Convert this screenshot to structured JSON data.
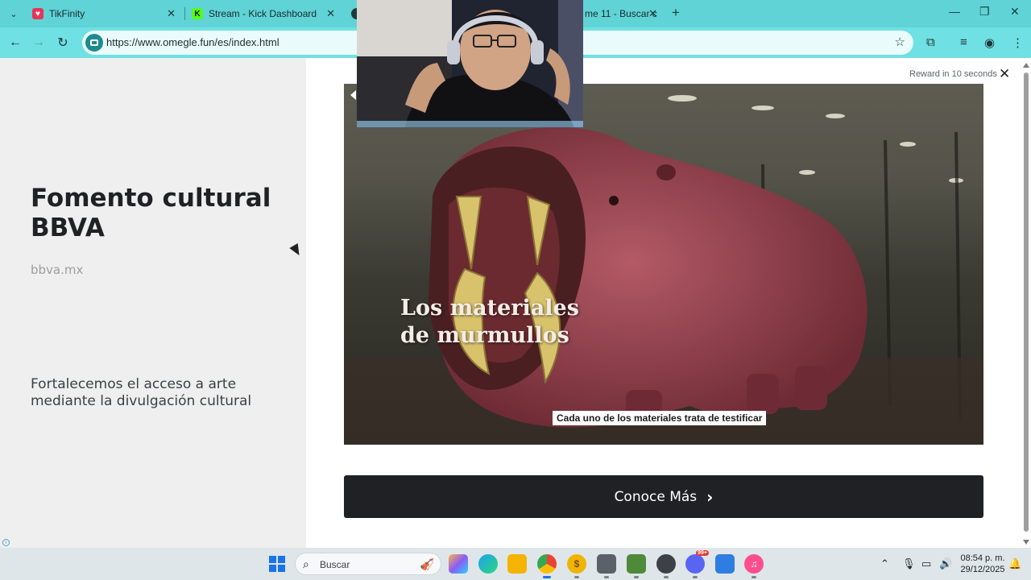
{
  "browser": {
    "tabs": [
      {
        "label": "TikFinity",
        "favicon": "tikfinity-icon",
        "color": "#e8345b"
      },
      {
        "label": "Stream - Kick Dashboard",
        "favicon": "kick-icon",
        "color": "#53fc18"
      },
      {
        "label": "",
        "favicon": "globe-icon",
        "color": "#1d3b3c"
      },
      {
        "label": "me 11 - Buscar c",
        "favicon": "",
        "color": ""
      }
    ],
    "url": "https://www.omegle.fun/es/index.html",
    "accent": "#5fd3d6"
  },
  "ad": {
    "title": "Fomento cultural BBVA",
    "domain": "bbva.mx",
    "description": "Fortalecemos el acceso a arte mediante la divulgación cultural",
    "reward": "Reward in 10 seconds",
    "cta_label": "Conoce Más",
    "video_overlay_line1": "Los materiales",
    "video_overlay_line2": "de murmullos",
    "video_caption": "Cada uno de los materiales trata de testificar"
  },
  "taskbar": {
    "search_placeholder": "Buscar",
    "time": "08:54 p. m.",
    "date": "29/12/2025",
    "badge": "99+"
  }
}
